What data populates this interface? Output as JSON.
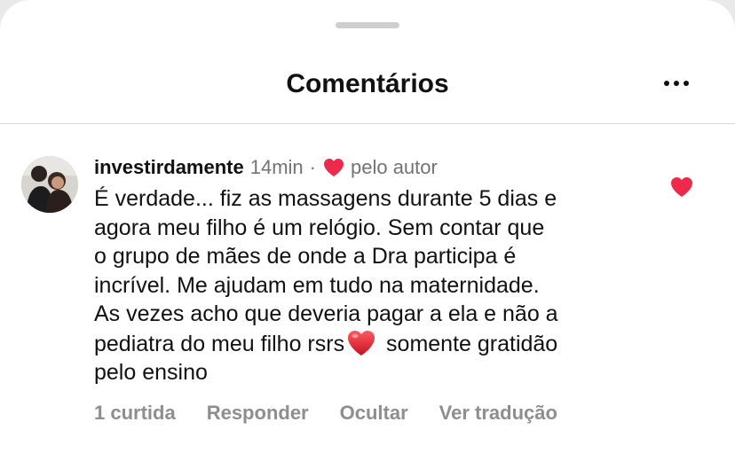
{
  "header": {
    "title": "Comentários",
    "more_icon": "more-horizontal-icon"
  },
  "colors": {
    "heart": "#ed2a4b",
    "muted": "#737373",
    "text": "#111111"
  },
  "comment": {
    "username": "investirdamente",
    "time": "14min",
    "separator": "·",
    "author_like_label": "pelo autor",
    "lines": [
      "É verdade... fiz as massagens durante 5 dias e",
      "agora meu filho é um relógio. Sem contar que",
      "o grupo de mães de onde a Dra participa é",
      "incrível. Me ajudam em tudo na maternidade.",
      "As vezes acho que deveria pagar a ela e não a"
    ],
    "line6_before_emoji": "pediatra do meu filho rsrs",
    "line6_after_emoji": " somente gratidão",
    "line7": "pelo ensino",
    "liked": true
  },
  "actions": {
    "likes": "1 curtida",
    "reply": "Responder",
    "hide": "Ocultar",
    "translate": "Ver tradução"
  }
}
